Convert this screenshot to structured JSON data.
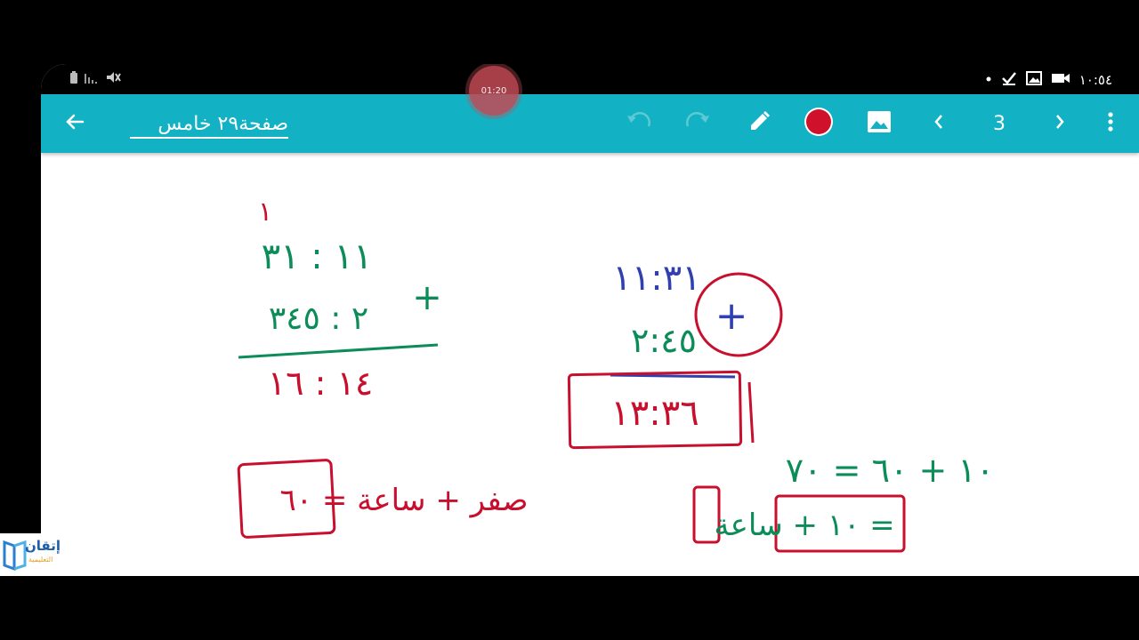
{
  "status_bar": {
    "time": "١٠:٥٤",
    "left_icons": [
      "battery-icon",
      "signal-icon",
      "mute-icon"
    ],
    "right_icons": [
      "dot-icon",
      "check-icon",
      "gallery-icon",
      "video-camera-icon"
    ]
  },
  "recording": {
    "timer": "01:20"
  },
  "toolbar": {
    "title": "صفحة٢٩ خامس",
    "page_number": "3",
    "pen_color": "#d0112b",
    "background_color": "#12b1c3"
  },
  "whiteboard": {
    "left_sum": {
      "carry": "١",
      "row1": "١١ : ٣١",
      "row2": "٢ : ٣٤٥",
      "operator": "+",
      "result": "١٤ : ١٦",
      "footnote": "صفر + ساعة = ٦٠"
    },
    "right_sum": {
      "row1": "١١:٣١",
      "row2": "٢:٤٥",
      "operator": "+",
      "result": "١٣:٣٦",
      "eq1": "١٠ + ٦٠ = ٧٠",
      "eq2": "١٠ + ساعة ="
    }
  },
  "watermark": {
    "brand": "إتقان",
    "tagline": "التعليمية"
  }
}
